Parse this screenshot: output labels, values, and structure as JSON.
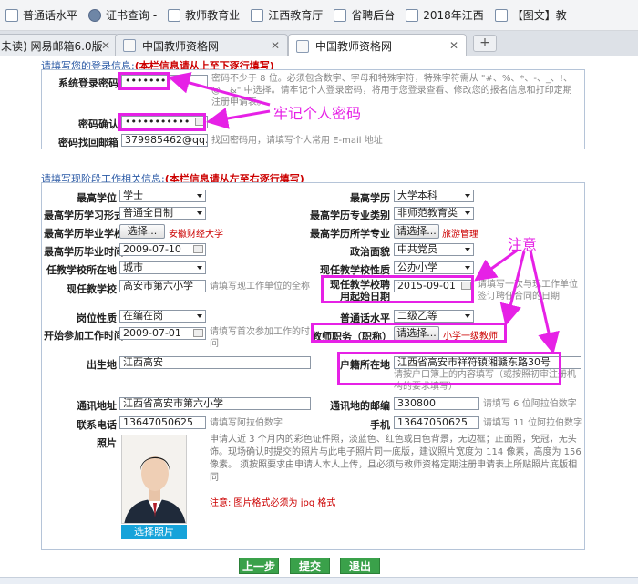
{
  "bookmarks": [
    "普通话水平",
    "证书查询 -",
    "教师教育业",
    "江西教育厅",
    "省聘后台",
    "2018年江西",
    "【图文】教"
  ],
  "tabs": [
    {
      "label": "未读) 网易邮箱6.0版"
    },
    {
      "label": "中国教师资格网"
    },
    {
      "label": "中国教师资格网"
    }
  ],
  "tabs_close": "✕",
  "new_tab": "+",
  "login": {
    "section_title": "请填写您的登录信息:",
    "section_note": "(本栏信息请从上至下逐行填写)",
    "password_label": "系统登录密码",
    "password_value": "•••••••••••",
    "password_hint": "密码不少于 8 位。必须包含数字、字母和特殊字符，特殊字符需从 \"#、%、*、-、_、!、@、&\" 中选择。请牢记个人登录密码，将用于您登录查看、修改您的报名信息和打印定期注册申请表。",
    "confirm_label": "密码确认",
    "confirm_value": "•••••••••••",
    "email_label": "密码找回邮箱",
    "email_value": "379985462@qq.com",
    "email_hint": "找回密码用，请填写个人常用 E-mail 地址"
  },
  "work": {
    "section_title": "请填写现阶段工作相关信息:",
    "section_note": "(本栏信息请从左至右逐行填写)",
    "degree_label": "最高学位",
    "degree_value": "学士",
    "education_label": "最高学历",
    "education_value": "大学本科",
    "study_form_label": "最高学历学习形式",
    "study_form_value": "普通全日制",
    "major_cat_label": "最高学历专业类别",
    "major_cat_value": "非师范教育类",
    "school_label": "最高学历毕业学校",
    "school_btn": "选择...",
    "school_value": "安徽财经大学",
    "major_label": "最高学历所学专业",
    "major_btn": "请选择...",
    "major_value": "旅游管理",
    "grad_time_label": "最高学历毕业时间",
    "grad_time_value": "2009-07-10",
    "political_label": "政治面貌",
    "political_value": "中共党员",
    "school_loc_label": "任教学校所在地",
    "school_loc_value": "城市",
    "school_type_label": "现任教学校性质",
    "school_type_value": "公办小学",
    "current_school_label": "现任教学校",
    "current_school_value": "高安市第六小学",
    "current_school_hint": "请填写现工作单位的全称",
    "hire_date_label": "现任教学校聘用起始日期",
    "hire_date_value": "2015-09-01",
    "hire_date_hint": "请填写一次与现工作单位签订聘任合同的日期",
    "post_label": "岗位性质",
    "post_value": "在编在岗",
    "mandarin_label": "普通话水平",
    "mandarin_value": "二级乙等",
    "start_work_label": "开始参加工作时间",
    "start_work_value": "2009-07-01",
    "start_work_hint": "请填写首次参加工作的时间",
    "title_label": "教师职务（职称）",
    "title_btn": "请选择...",
    "title_value": "小学一级教师",
    "birthplace_label": "出生地",
    "birthplace_value": "江西高安",
    "hukou_label": "户籍所在地",
    "hukou_value": "江西省高安市祥符镇湘赣东路30号",
    "hukou_hint": "请按户口簿上的内容填写（或按照初审注册机构的要求填写）",
    "address_label": "通讯地址",
    "address_value": "江西省高安市第六小学",
    "postcode_label": "通讯地的邮编",
    "postcode_value": "330800",
    "postcode_hint": "请填写 6 位阿拉伯数字",
    "phone_label": "联系电话",
    "phone_value": "13647050625",
    "phone_hint": "请填写阿拉伯数字",
    "mobile_label": "手机",
    "mobile_value": "13647050625",
    "mobile_hint": "请填写 11 位阿拉伯数字",
    "photo_label": "照片",
    "photo_hint": "申请人近 3 个月内的彩色证件照，淡蓝色、红色或白色背景，无边框；正面照，免冠，无头饰。现场确认时提交的照片与此电子照片同一底版，建议照片宽度为 114 像素，高度为 156 像素。 须按照要求由申请人本人上传，且必须与教师资格定期注册申请表上所贴照片底版相同",
    "photo_format_hint": "注意: 图片格式必须为 jpg 格式",
    "photo_btn": "选择照片"
  },
  "buttons": {
    "prev": "上一步",
    "submit": "提交",
    "exit": "退出"
  },
  "annotations": {
    "remember_password": "牢记个人密码",
    "note": "注意"
  },
  "colors": {
    "annotation": "#e621e6",
    "required_note": "#cc0000",
    "nav_button": "#3aa14a",
    "photo_button": "#16a3da"
  }
}
